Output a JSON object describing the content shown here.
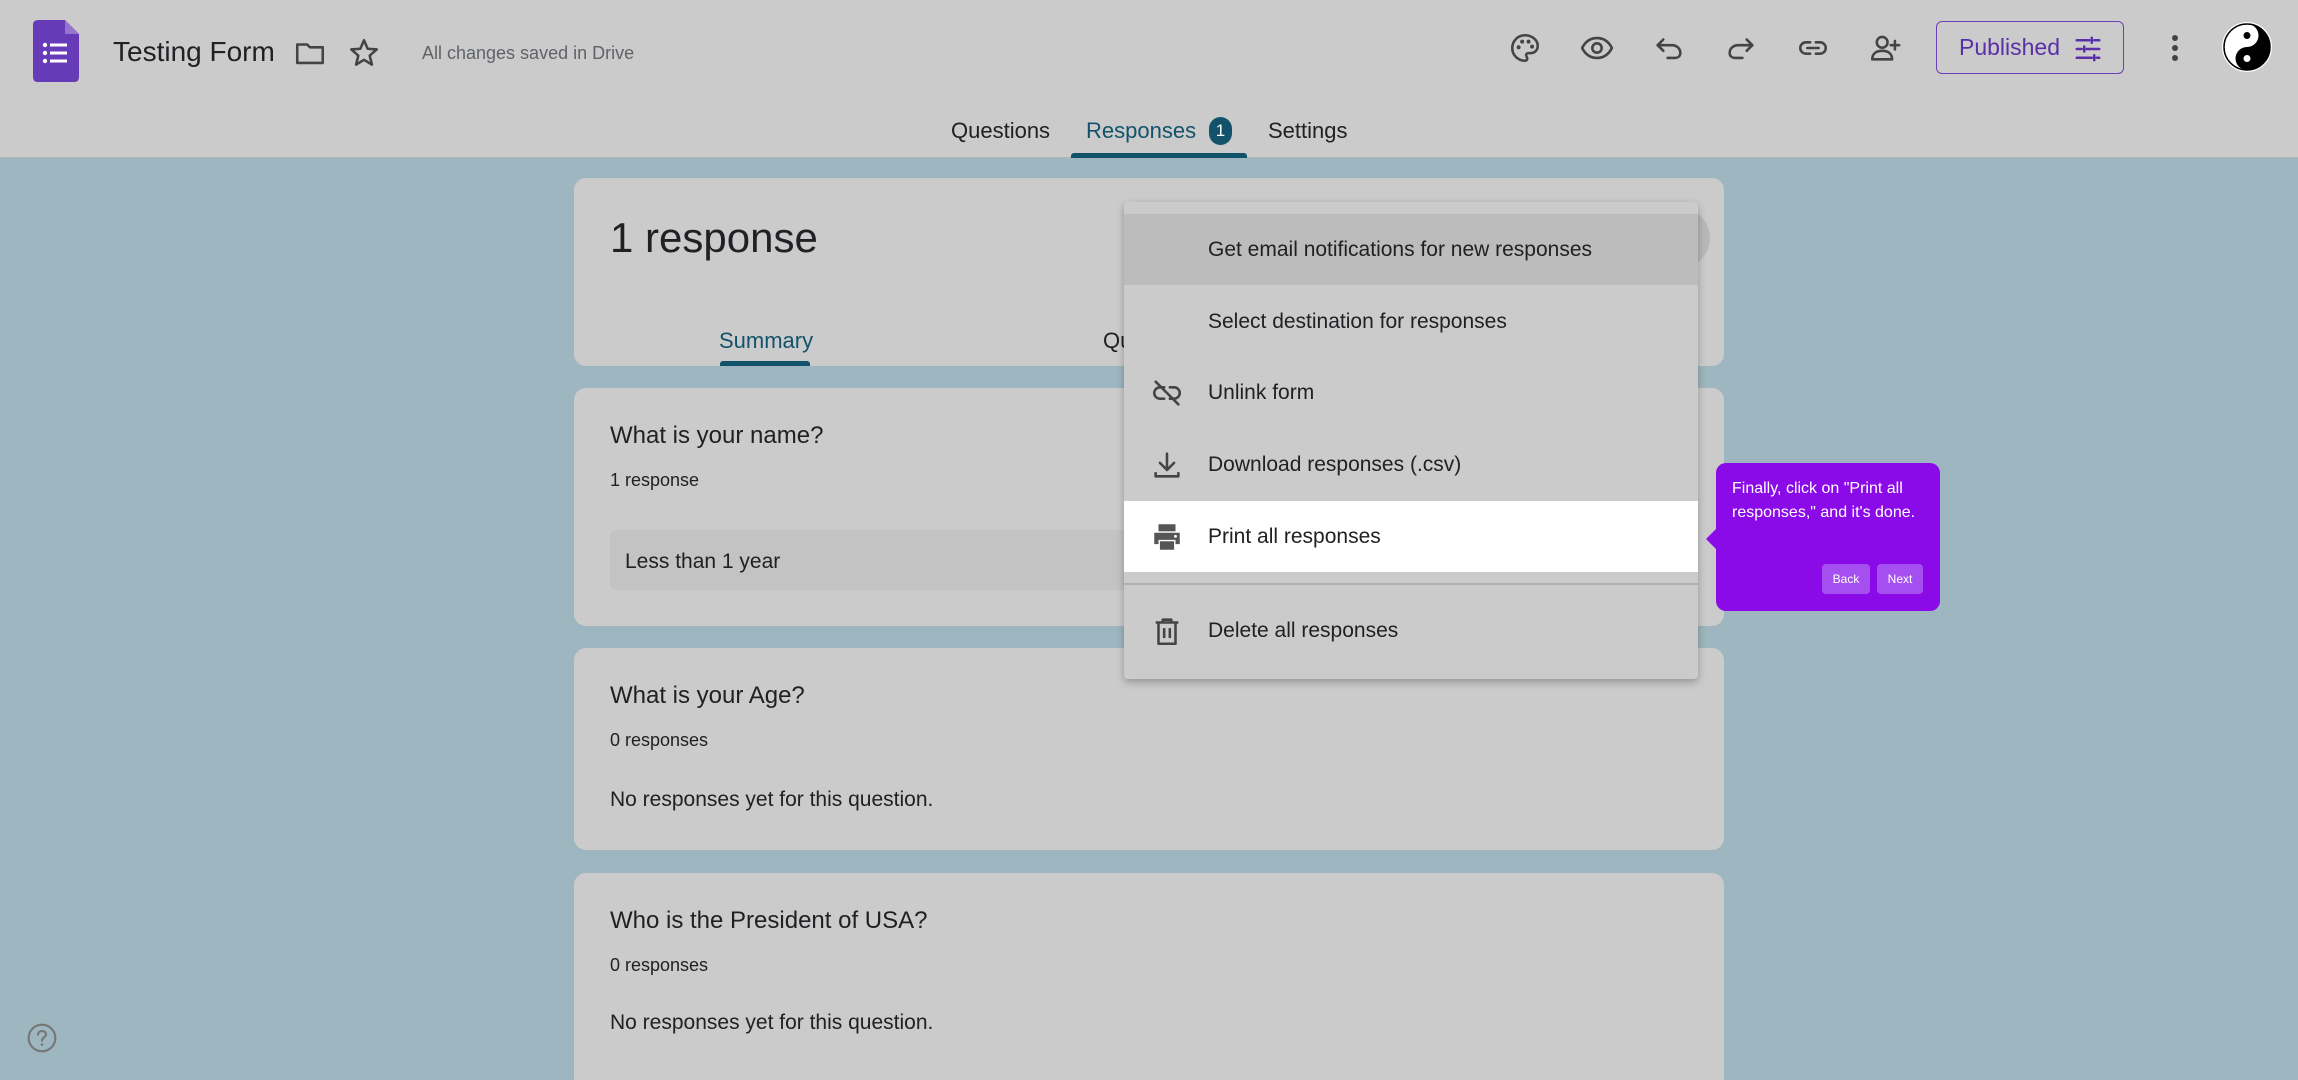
{
  "header": {
    "doc_title": "Testing Form",
    "save_status": "All changes saved in Drive",
    "published_label": "Published",
    "icons": [
      "forms-app-icon",
      "folder-icon",
      "star-icon",
      "palette-icon",
      "preview-eye-icon",
      "undo-icon",
      "redo-icon",
      "link-icon",
      "add-collaborator-icon",
      "tune-icon",
      "more-vert-icon",
      "avatar"
    ]
  },
  "tabs": [
    {
      "label": "Questions",
      "active": false
    },
    {
      "label": "Responses",
      "active": true,
      "badge": "1"
    },
    {
      "label": "Settings",
      "active": false
    }
  ],
  "summary_card": {
    "title": "1 response",
    "subtabs": [
      "Summary",
      "Qu"
    ]
  },
  "questions": [
    {
      "title": "What is your name?",
      "count": "1 response",
      "answer": "Less than 1 year"
    },
    {
      "title": "What is your Age?",
      "count": "0 responses",
      "empty": "No responses yet for this question."
    },
    {
      "title": "Who is the President of USA?",
      "count": "0 responses",
      "empty": "No responses yet for this question."
    }
  ],
  "menu": {
    "items": [
      {
        "label": "Get email notifications for new responses",
        "icon": ""
      },
      {
        "label": "Select destination for responses",
        "icon": ""
      },
      {
        "label": "Unlink form",
        "icon": "link-off-icon"
      },
      {
        "label": "Download responses (.csv)",
        "icon": "download-icon"
      },
      {
        "label": "Print all responses",
        "icon": "print-icon"
      },
      {
        "label": "Delete all responses",
        "icon": "trash-icon"
      }
    ]
  },
  "tooltip": {
    "text": "Finally, click on \"Print all responses,\" and it's done.",
    "back_label": "Back",
    "next_label": "Next"
  },
  "colors": {
    "accent": "#12536b",
    "brand_purple": "#5b2fa8",
    "tooltip_bg": "#8b0ae8",
    "backdrop": "#9db6bf"
  }
}
